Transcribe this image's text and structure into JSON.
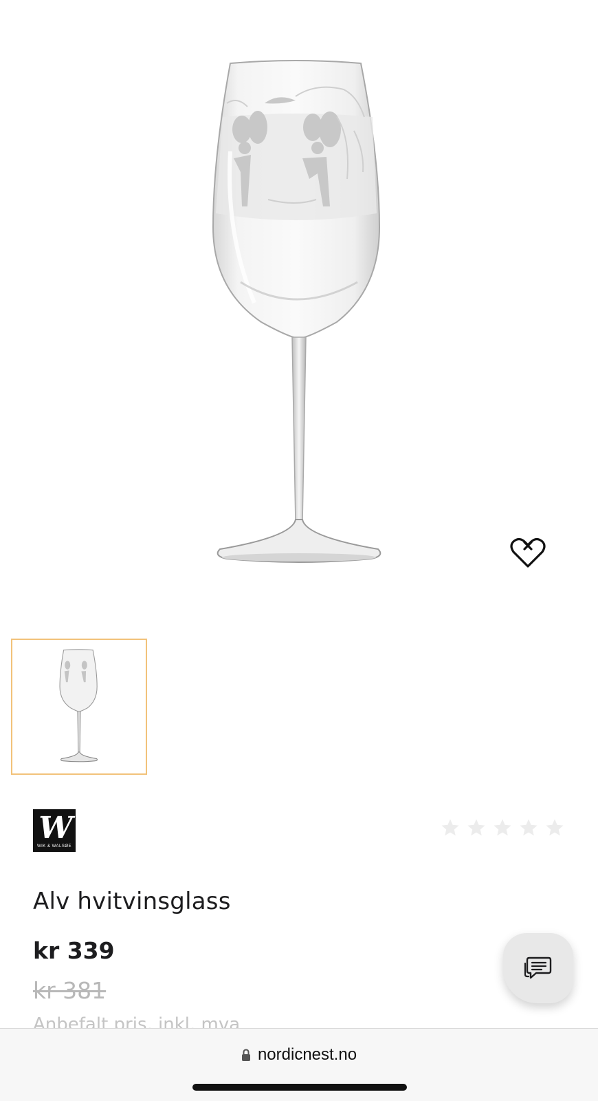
{
  "product": {
    "title": "Alv hvitvinsglass",
    "price": "kr 339",
    "old_price": "kr 381",
    "price_note": "Anbefalt pris, inkl. mva",
    "rating_stars_filled": 0,
    "rating_stars_total": 5
  },
  "brand": {
    "logo_monogram": "W",
    "logo_text": "WIK & WALSØE"
  },
  "icons": {
    "wishlist": "heart-add-icon",
    "star": "star-icon",
    "chat": "chat-bubble-icon",
    "lock": "lock-icon"
  },
  "colors": {
    "thumb_border": "#f2c27a",
    "star_empty": "#ececec",
    "old_price": "#b8b8b8",
    "chat_bg": "#e8e8e8"
  },
  "browser": {
    "url": "nordicnest.no"
  }
}
